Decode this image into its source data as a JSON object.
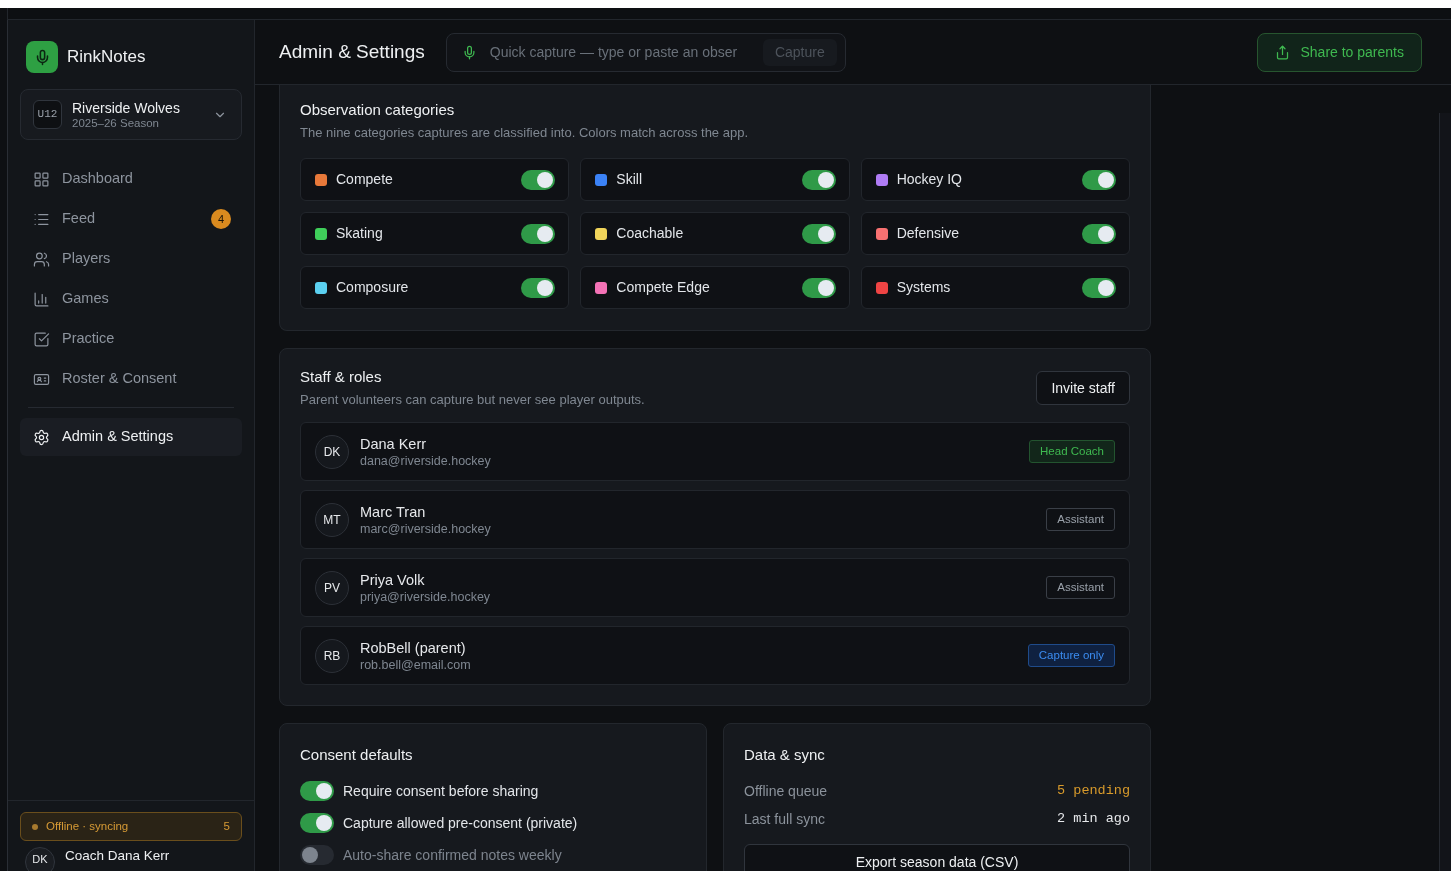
{
  "sidebar": {
    "brand": "RinkNotes",
    "team": {
      "badge": "U12",
      "name": "Riverside Wolves",
      "season": "2025–26 Season"
    },
    "nav": [
      {
        "label": "Dashboard",
        "selected": false
      },
      {
        "label": "Feed",
        "selected": false,
        "badge": "4"
      },
      {
        "label": "Players",
        "selected": false
      },
      {
        "label": "Games",
        "selected": false
      },
      {
        "label": "Practice",
        "selected": false
      },
      {
        "label": "Roster & Consent",
        "selected": false
      }
    ],
    "settings_nav": [
      {
        "label": "Admin & Settings",
        "selected": true
      }
    ],
    "sync_status": {
      "label": "Offline · syncing",
      "count": "5"
    },
    "user": {
      "initials": "DK",
      "name": "Coach Dana Kerr"
    }
  },
  "header": {
    "title": "Admin & Settings",
    "quick_capture": {
      "placeholder": "Quick capture — type or paste an obser",
      "button": {
        "label": "Capture",
        "disabled": true
      }
    },
    "share_button": "Share to parents"
  },
  "categories": {
    "title": "Observation categories",
    "subtitle": "The nine categories captures are classified into. Colors match across the app.",
    "items": [
      {
        "label": "Compete",
        "color": "#e8793a",
        "on": true
      },
      {
        "label": "Skill",
        "color": "#3b82f6",
        "on": true
      },
      {
        "label": "Hockey IQ",
        "color": "#b07cf5",
        "on": true
      },
      {
        "label": "Skating",
        "color": "#3fcf5a",
        "on": true
      },
      {
        "label": "Coachable",
        "color": "#f0d45a",
        "on": true
      },
      {
        "label": "Defensive",
        "color": "#f87171",
        "on": true
      },
      {
        "label": "Composure",
        "color": "#5bd0f0",
        "on": true
      },
      {
        "label": "Compete Edge",
        "color": "#f472b6",
        "on": true
      },
      {
        "label": "Systems",
        "color": "#ef4444",
        "on": true
      }
    ]
  },
  "staff": {
    "title": "Staff & roles",
    "subtitle": "Parent volunteers can capture but never see player outputs.",
    "invite_button": "Invite staff",
    "members": [
      {
        "initials": "DK",
        "name": "Dana Kerr",
        "email": "dana@riverside.hockey",
        "role": "Head Coach",
        "kind": "lead"
      },
      {
        "initials": "MT",
        "name": "Marc Tran",
        "email": "marc@riverside.hockey",
        "role": "Assistant",
        "kind": "assistant"
      },
      {
        "initials": "PV",
        "name": "Priya Volk",
        "email": "priya@riverside.hockey",
        "role": "Assistant",
        "kind": "assistant"
      },
      {
        "initials": "RB",
        "name": "RobBell (parent)",
        "email": "rob.bell@email.com",
        "role": "Capture only",
        "kind": "capture"
      }
    ]
  },
  "consent": {
    "title": "Consent defaults",
    "options": [
      {
        "label": "Require consent before sharing",
        "on": true
      },
      {
        "label": "Capture allowed pre-consent (private)",
        "on": true
      },
      {
        "label": "Auto-share confirmed notes weekly",
        "on": false
      }
    ]
  },
  "data_sync": {
    "title": "Data & sync",
    "rows": [
      {
        "label": "Offline queue",
        "value": "5 pending",
        "kind": "warning"
      },
      {
        "label": "Last full sync",
        "value": "2 min ago",
        "kind": "plain"
      }
    ],
    "export_button": "Export season data (CSV)"
  }
}
